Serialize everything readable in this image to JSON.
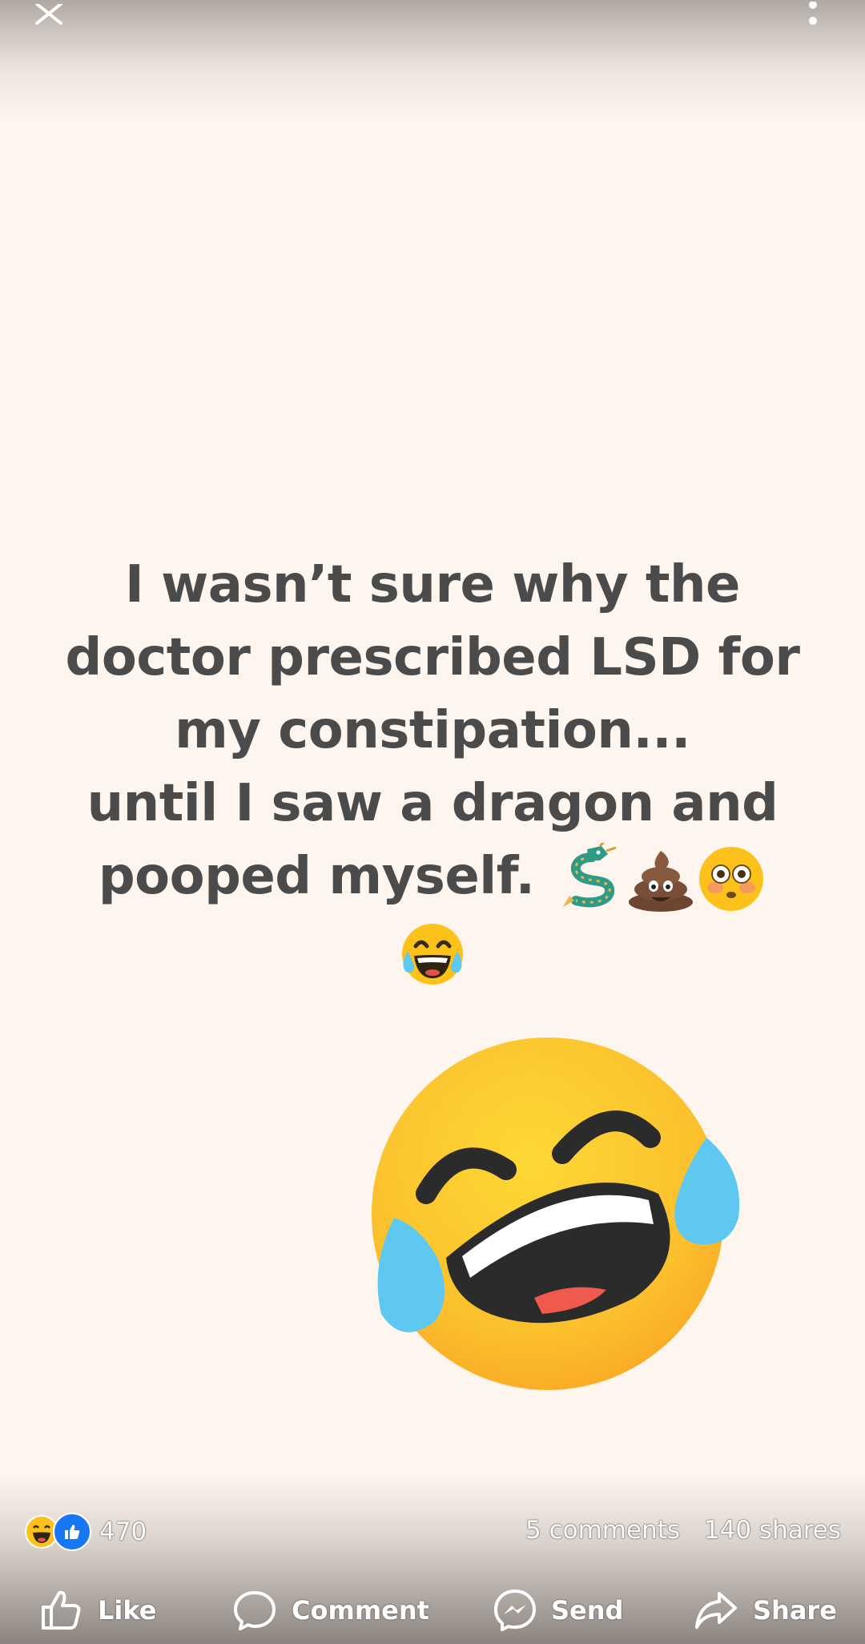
{
  "post": {
    "lines": [
      "I wasn’t sure why the",
      "doctor prescribed LSD for",
      "my constipation...",
      "until I saw a dragon and",
      "pooped myself."
    ],
    "inline_emojis": [
      "dragon-emoji",
      "poop-emoji",
      "flushed-face-emoji",
      "tears-of-joy-emoji"
    ],
    "large_emoji": "tears-of-joy-emoji"
  },
  "stats": {
    "reaction_count": "470",
    "comments": "5 comments",
    "shares": "140 shares"
  },
  "actions": {
    "like": "Like",
    "comment": "Comment",
    "send": "Send",
    "share": "Share"
  },
  "icons": {
    "close": "close-icon",
    "more": "more-options-icon",
    "like": "thumbs-up-icon",
    "comment": "comment-bubble-icon",
    "send": "messenger-icon",
    "share": "share-arrow-icon"
  },
  "colors": {
    "background": "#fdf5ee",
    "text": "#4b4b4b",
    "like_blue": "#1877f2",
    "emoji_yellow": "#fcc21b",
    "tear_blue": "#5ec8f0"
  }
}
